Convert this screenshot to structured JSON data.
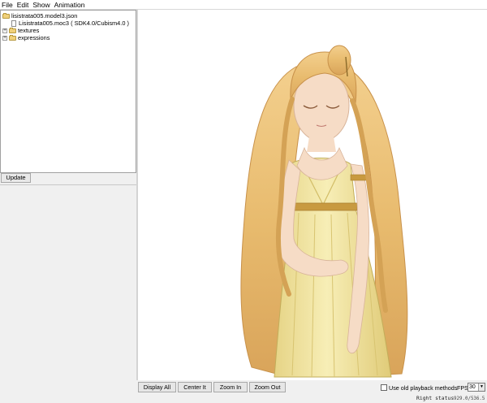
{
  "menubar": {
    "items": [
      "File",
      "Edit",
      "Show",
      "Animation"
    ]
  },
  "tree": {
    "root": "lisistrata005.model3.json",
    "moc": "Lisistrata005.moc3 ( SDK4.0/Cubism4.0 )",
    "folders": [
      "textures",
      "expressions"
    ]
  },
  "left": {
    "update_label": "Update"
  },
  "toolbar": {
    "display_all": "Display All",
    "center_it": "Center It",
    "zoom_in": "Zoom In",
    "zoom_out": "Zoom Out",
    "old_playback_label": "Use old playback methods",
    "old_playback_checked": false,
    "fps_label": "FPS",
    "fps_value": "30"
  },
  "status": {
    "right_status": "Right status",
    "coords": "929.0/536.5"
  },
  "colors": {
    "hair": "#e8bb6e",
    "hair_shadow": "#c8914a",
    "skin": "#f6dcc6",
    "dress": "#f4e9a8",
    "dress_shadow": "#d8c471",
    "gold": "#c89a40"
  }
}
